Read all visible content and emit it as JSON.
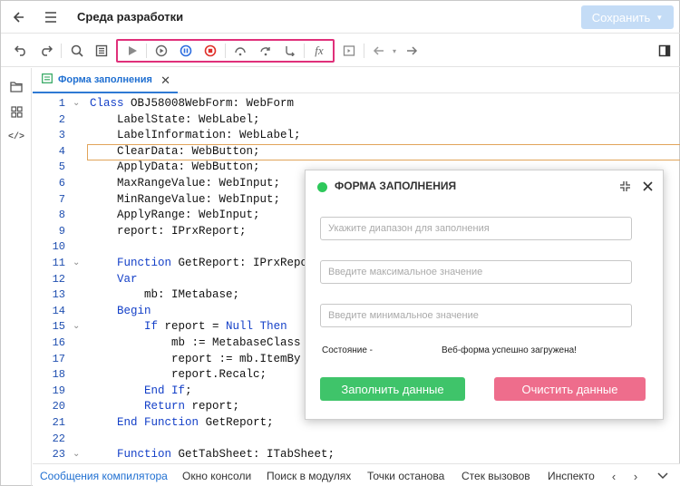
{
  "header": {
    "title": "Среда разработки",
    "save_label": "Сохранить"
  },
  "editor_tab": {
    "label": "Форма заполнения"
  },
  "code": {
    "lines": [
      {
        "n": "1",
        "fold": "⌄",
        "text": "Class OBJ58008WebForm: WebForm"
      },
      {
        "n": "2",
        "fold": "",
        "text": "    LabelState: WebLabel;"
      },
      {
        "n": "3",
        "fold": "",
        "text": "    LabelInformation: WebLabel;"
      },
      {
        "n": "4",
        "fold": "",
        "text": "    ClearData: WebButton;"
      },
      {
        "n": "5",
        "fold": "",
        "text": "    ApplyData: WebButton;"
      },
      {
        "n": "6",
        "fold": "",
        "text": "    MaxRangeValue: WebInput;"
      },
      {
        "n": "7",
        "fold": "",
        "text": "    MinRangeValue: WebInput;"
      },
      {
        "n": "8",
        "fold": "",
        "text": "    ApplyRange: WebInput;"
      },
      {
        "n": "9",
        "fold": "",
        "text": "    report: IPrxReport;"
      },
      {
        "n": "10",
        "fold": "",
        "text": ""
      },
      {
        "n": "11",
        "fold": "⌄",
        "text": "    Function GetReport: IPrxRepo"
      },
      {
        "n": "12",
        "fold": "",
        "text": "    Var"
      },
      {
        "n": "13",
        "fold": "",
        "text": "        mb: IMetabase;"
      },
      {
        "n": "14",
        "fold": "",
        "text": "    Begin"
      },
      {
        "n": "15",
        "fold": "⌄",
        "text": "        If report = Null Then"
      },
      {
        "n": "16",
        "fold": "",
        "text": "            mb := MetabaseClass"
      },
      {
        "n": "17",
        "fold": "",
        "text": "            report := mb.ItemBy"
      },
      {
        "n": "18",
        "fold": "",
        "text": "            report.Recalc;"
      },
      {
        "n": "19",
        "fold": "",
        "text": "        End If;"
      },
      {
        "n": "20",
        "fold": "",
        "text": "        Return report;"
      },
      {
        "n": "21",
        "fold": "",
        "text": "    End Function GetReport;"
      },
      {
        "n": "22",
        "fold": "",
        "text": ""
      },
      {
        "n": "23",
        "fold": "⌄",
        "text": "    Function GetTabSheet: ITabSheet;"
      }
    ]
  },
  "bottom_tabs": [
    "Сообщения компилятора",
    "Окно консоли",
    "Поиск в модулях",
    "Точки останова",
    "Стек вызовов",
    "Инспекто"
  ],
  "dialog": {
    "title": "ФОРМА ЗАПОЛНЕНИЯ",
    "range_placeholder": "Укажите диапазон для заполнения",
    "max_placeholder": "Введите максимальное значение",
    "min_placeholder": "Введите минимальное значение",
    "state_label": "Состояние -",
    "info_label": "Веб-форма успешно загружена!",
    "fill_button": "Заполнить данные",
    "clear_button": "Очистить данные"
  },
  "colors": {
    "accent": "#2f7ad4",
    "highlight": "#e0307a",
    "fill_button": "#3fc46a",
    "clear_button": "#ee6d8c",
    "status_dot": "#2ec85b"
  }
}
